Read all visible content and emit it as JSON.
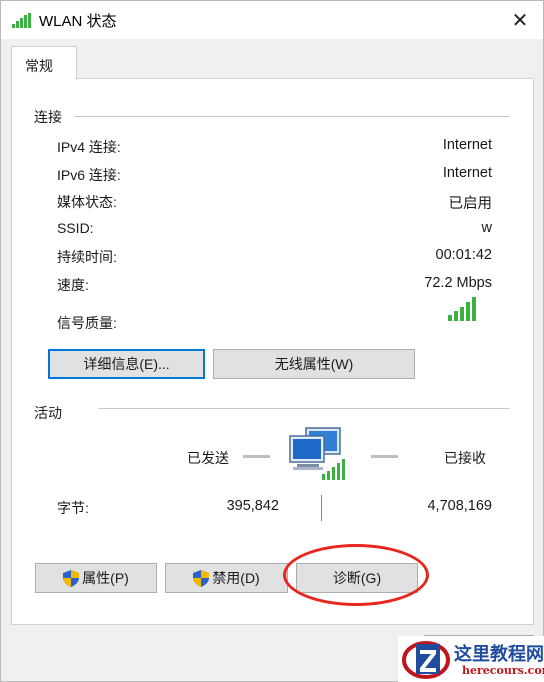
{
  "window": {
    "title": "WLAN 状态",
    "close_glyph": "✕"
  },
  "tabs": [
    {
      "label": "常规"
    }
  ],
  "connection": {
    "section_title": "连接",
    "rows": [
      {
        "label": "IPv4 连接:",
        "value": "Internet"
      },
      {
        "label": "IPv6 连接:",
        "value": "Internet"
      },
      {
        "label": "媒体状态:",
        "value": "已启用"
      },
      {
        "label": "SSID:",
        "value": "w"
      },
      {
        "label": "持续时间:",
        "value": "00:01:42"
      },
      {
        "label": "速度:",
        "value": "72.2 Mbps"
      }
    ],
    "signal_label": "信号质量:",
    "signal_icon": "signal-bars-icon",
    "signal_bars": 5,
    "details_button": "详细信息(E)...",
    "wireless_props_button": "无线属性(W)"
  },
  "activity": {
    "section_title": "活动",
    "sent_label": "已发送",
    "received_label": "已接收",
    "bytes_label": "字节:",
    "bytes_sent": "395,842",
    "bytes_received": "4,708,169",
    "network_icon": "network-computers-icon"
  },
  "buttons": {
    "properties": "属性(P)",
    "disable": "禁用(D)",
    "diagnose": "诊断(G)"
  },
  "watermark": {
    "line1": "这里教程网",
    "line2": "herecours.com"
  },
  "colors": {
    "signal_green": "#3cb043",
    "annotation_red": "#e8261e",
    "focus_blue": "#0078d7"
  }
}
